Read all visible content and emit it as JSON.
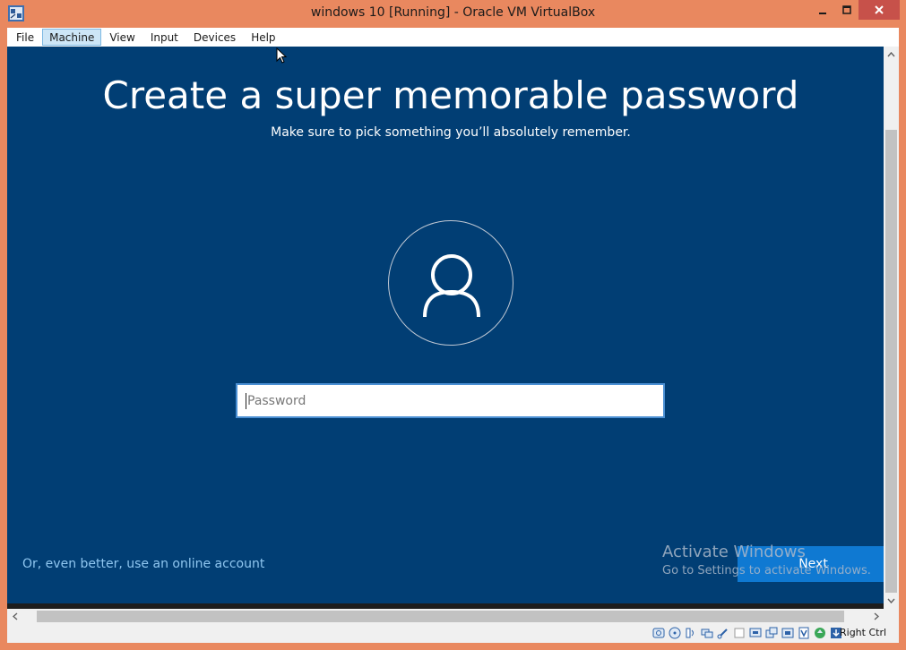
{
  "window": {
    "title": "windows 10 [Running] - Oracle VM VirtualBox"
  },
  "menu": {
    "items": [
      {
        "label": "File"
      },
      {
        "label": "Machine"
      },
      {
        "label": "View"
      },
      {
        "label": "Input"
      },
      {
        "label": "Devices"
      },
      {
        "label": "Help"
      }
    ],
    "active": "Machine"
  },
  "setup": {
    "heading": "Create a super memorable password",
    "subheading": "Make sure to pick something you’ll absolutely remember.",
    "password_placeholder": "Password",
    "online_link": "Or, even better, use an online account",
    "next_label": "Next"
  },
  "watermark": {
    "title": "Activate Windows",
    "subtitle": "Go to Settings to activate Windows."
  },
  "statusbar": {
    "host_key": "Right Ctrl",
    "icons": [
      "hard-disk-icon",
      "optical-drive-icon",
      "audio-icon",
      "network-icon",
      "usb-icon",
      "shared-folders-icon",
      "display-icon",
      "video-capture-icon",
      "recording-icon",
      "virtualization-icon",
      "mouse-integration-icon",
      "keyboard-capture-icon"
    ]
  },
  "colors": {
    "frame": "#e9885f",
    "guest_background": "#013e74",
    "next_button": "#0f79d2",
    "link": "#8fc6f0",
    "close_button": "#c7514a"
  }
}
